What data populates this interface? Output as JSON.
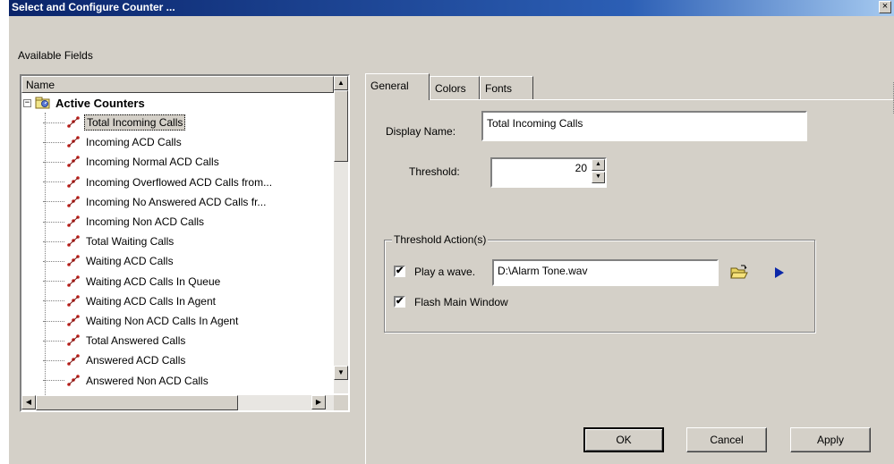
{
  "window": {
    "title": "Select and Configure Counter ...",
    "close_glyph": "×"
  },
  "available_fields_label": "Available Fields",
  "tree": {
    "column_header": "Name",
    "root": {
      "label": "Active Counters",
      "expander": "−"
    },
    "items": [
      {
        "label": "Total Incoming Calls",
        "selected": true
      },
      {
        "label": "Incoming ACD Calls"
      },
      {
        "label": "Incoming Normal ACD Calls"
      },
      {
        "label": "Incoming Overflowed ACD Calls from..."
      },
      {
        "label": "Incoming No Answered ACD Calls fr..."
      },
      {
        "label": "Incoming Non ACD Calls"
      },
      {
        "label": "Total Waiting Calls"
      },
      {
        "label": "Waiting ACD Calls"
      },
      {
        "label": "Waiting ACD Calls In Queue"
      },
      {
        "label": "Waiting ACD Calls In Agent"
      },
      {
        "label": "Waiting Non ACD Calls In Agent"
      },
      {
        "label": "Total Answered Calls"
      },
      {
        "label": "Answered ACD Calls"
      },
      {
        "label": "Answered Non ACD Calls"
      }
    ]
  },
  "tabs": [
    {
      "label": "General",
      "active": true
    },
    {
      "label": "Colors"
    },
    {
      "label": "Fonts"
    }
  ],
  "general": {
    "display_name_label": "Display Name:",
    "display_name_value": "Total Incoming Calls",
    "threshold_label": "Threshold:",
    "threshold_value": "20",
    "threshold_action_title": "Threshold Action(s)",
    "play_wave_label": "Play a wave.",
    "play_wave_checked": true,
    "wave_path": "D:\\Alarm Tone.wav",
    "flash_label": "Flash Main Window",
    "flash_checked": true
  },
  "buttons": {
    "ok": "OK",
    "cancel": "Cancel",
    "apply": "Apply"
  },
  "glyphs": {
    "check": "✔",
    "up": "▲",
    "down": "▼",
    "left": "◀",
    "right": "▶"
  },
  "colors": {
    "title_start": "#0a246a",
    "title_end": "#a6caf0",
    "dialog_bg": "#d4d0c8",
    "play_arrow": "#0b27a8"
  }
}
